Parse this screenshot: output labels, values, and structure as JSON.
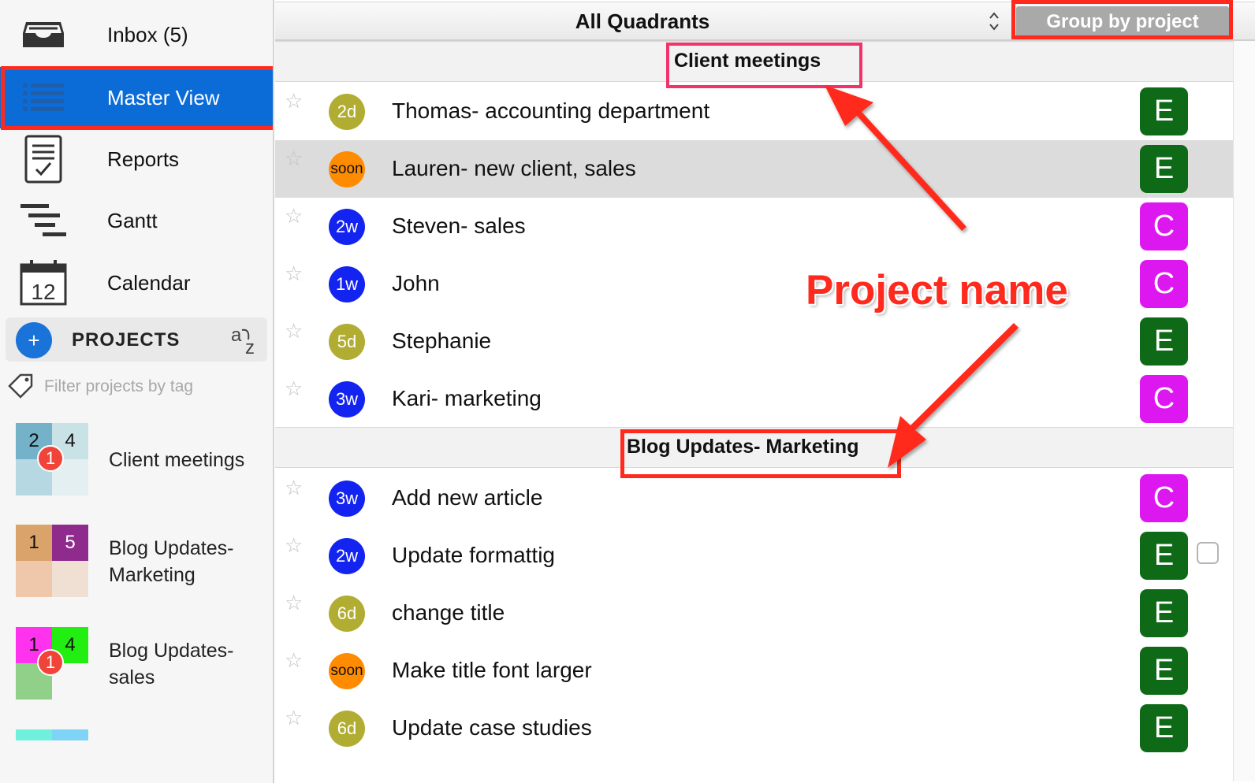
{
  "sidebar": {
    "nav": [
      {
        "label": "Inbox (5)",
        "icon": "inbox-icon"
      },
      {
        "label": "Master View",
        "icon": "list-icon"
      },
      {
        "label": "Reports",
        "icon": "report-icon"
      },
      {
        "label": "Gantt",
        "icon": "gantt-icon"
      },
      {
        "label": "Calendar",
        "icon": "calendar-icon",
        "icon_text": "12"
      }
    ],
    "projects_title": "PROJECTS",
    "add_symbol": "+",
    "sort_symbol": "a z",
    "filter_placeholder": "Filter projects by tag",
    "projects": [
      {
        "name": "Client meetings",
        "quadrants": [
          "2",
          "4",
          "",
          ""
        ],
        "badge": "1",
        "colors": [
          "#74b2c9",
          "#c9e2e6",
          "#b5d8e3",
          "#e3eff0"
        ]
      },
      {
        "name": "Blog Updates- Marketing",
        "quadrants": [
          "1",
          "5",
          "",
          ""
        ],
        "badge": "",
        "colors": [
          "#d9a36a",
          "#8e2b8c",
          "#efc8ac",
          "#f0e0d3"
        ]
      },
      {
        "name": "Blog Updates- sales",
        "quadrants": [
          "1",
          "4",
          "",
          ""
        ],
        "badge": "1",
        "colors": [
          "#ff33ee",
          "#22ee11",
          "#90d089",
          "#f6f6f6"
        ]
      }
    ]
  },
  "toolbar": {
    "quadrant_select": "All Quadrants",
    "group_button": "Group by project"
  },
  "groups": [
    {
      "title": "Client meetings",
      "tasks": [
        {
          "title": "Thomas- accounting department",
          "due": "2d",
          "due_color": "#b1ad33",
          "quadrant": "E",
          "quadrant_color": "#0e6a16",
          "selected": false
        },
        {
          "title": "Lauren- new client, sales",
          "due": "soon",
          "due_color": "#ff8c00",
          "quadrant": "E",
          "quadrant_color": "#0e6a16",
          "selected": true
        },
        {
          "title": "Steven- sales",
          "due": "2w",
          "due_color": "#1424f0",
          "quadrant": "C",
          "quadrant_color": "#dd17f0",
          "selected": false
        },
        {
          "title": "John",
          "due": "1w",
          "due_color": "#1424f0",
          "quadrant": "C",
          "quadrant_color": "#dd17f0",
          "selected": false
        },
        {
          "title": "Stephanie",
          "due": "5d",
          "due_color": "#b1ad33",
          "quadrant": "E",
          "quadrant_color": "#0e6a16",
          "selected": false
        },
        {
          "title": "Kari- marketing",
          "due": "3w",
          "due_color": "#1424f0",
          "quadrant": "C",
          "quadrant_color": "#dd17f0",
          "selected": false
        }
      ]
    },
    {
      "title": "Blog Updates- Marketing",
      "tasks": [
        {
          "title": "Add new article",
          "due": "3w",
          "due_color": "#1424f0",
          "quadrant": "C",
          "quadrant_color": "#dd17f0",
          "selected": false
        },
        {
          "title": "Update formattig",
          "due": "2w",
          "due_color": "#1424f0",
          "quadrant": "E",
          "quadrant_color": "#0e6a16",
          "selected": false,
          "checkbox": true
        },
        {
          "title": "change title",
          "due": "6d",
          "due_color": "#b1ad33",
          "quadrant": "E",
          "quadrant_color": "#0e6a16",
          "selected": false
        },
        {
          "title": "Make title font larger",
          "due": "soon",
          "due_color": "#ff8c00",
          "quadrant": "E",
          "quadrant_color": "#0e6a16",
          "selected": false
        },
        {
          "title": "Update case studies",
          "due": "6d",
          "due_color": "#b1ad33",
          "quadrant": "E",
          "quadrant_color": "#0e6a16",
          "selected": false
        }
      ]
    }
  ],
  "annotation": {
    "label": "Project name",
    "color": "#ff2a1d"
  },
  "star_symbol": "☆"
}
